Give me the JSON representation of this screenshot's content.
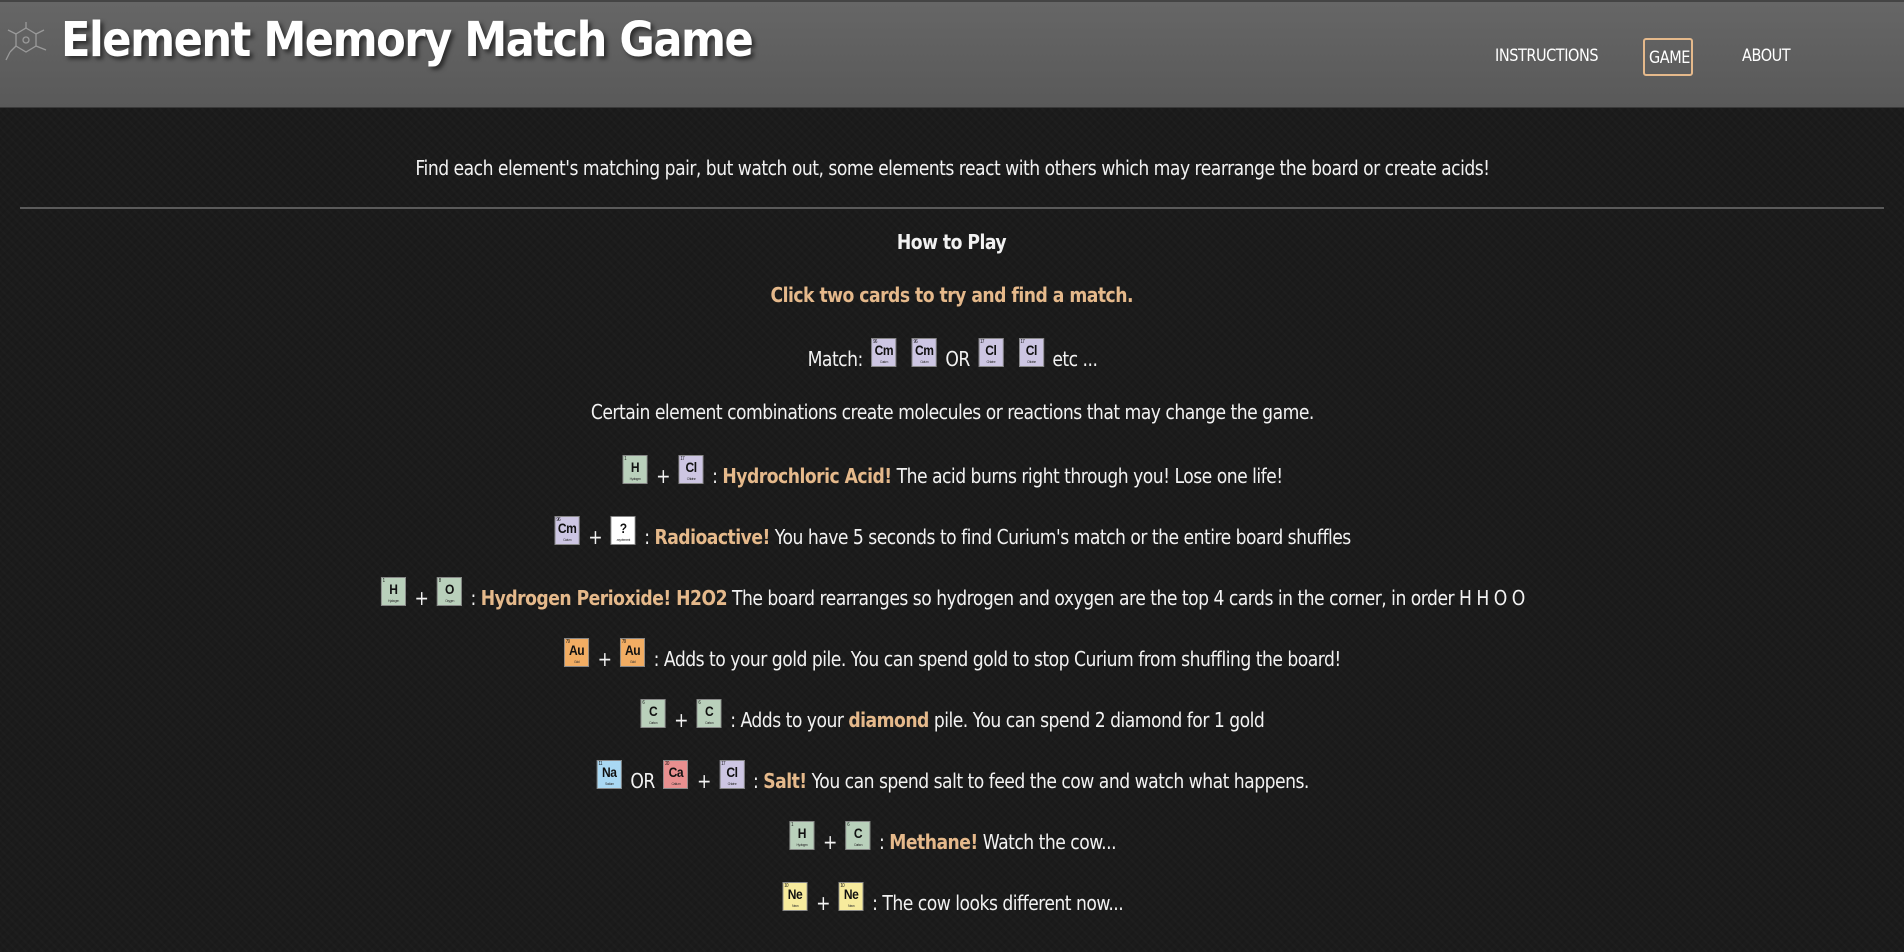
{
  "header": {
    "title": "Element Memory Match Game",
    "nav": [
      {
        "label": "INSTRUCTIONS",
        "active": false
      },
      {
        "label": "GAME",
        "active": true
      },
      {
        "label": "ABOUT",
        "active": false
      }
    ]
  },
  "colors": {
    "header_bg": "#5e5e5e",
    "page_bg": "#1b1b1b",
    "accent": "#e5b98b",
    "tile_green": "#b9d0bb",
    "tile_purple": "#cdc6e3",
    "tile_orange": "#f2ad63",
    "tile_blue": "#a9d8f3",
    "tile_red": "#e88f8f",
    "tile_yellow": "#f7eb9d",
    "tile_white": "#ffffff"
  },
  "intro": "Find each element's matching pair, but watch out, some elements react with others which may rearrange the board or create acids!",
  "how_to_play": {
    "heading": "How to Play",
    "instruction": "Click two cards to try and find a match.",
    "match_label": "Match:",
    "or_label": "OR",
    "etc_label": "etc ...",
    "combos_intro": "Certain element combinations create molecules or reactions that may change the game."
  },
  "tiles": {
    "cm": {
      "symbol": "Cm",
      "number": "96",
      "name": "Curium",
      "color": "#cdc6e3"
    },
    "cl": {
      "symbol": "Cl",
      "number": "17",
      "name": "Chlorine",
      "color": "#cdc6e3"
    },
    "h": {
      "symbol": "H",
      "number": "1",
      "name": "Hydrogen",
      "color": "#b9d0bb"
    },
    "o": {
      "symbol": "O",
      "number": "8",
      "name": "Oxygen",
      "color": "#b9d0bb"
    },
    "c": {
      "symbol": "C",
      "number": "6",
      "name": "Carbon",
      "color": "#b9d0bb"
    },
    "au": {
      "symbol": "Au",
      "number": "79",
      "name": "Gold",
      "color": "#f2ad63"
    },
    "na": {
      "symbol": "Na",
      "number": "11",
      "name": "Sodium",
      "color": "#a9d8f3"
    },
    "ca": {
      "symbol": "Ca",
      "number": "20",
      "name": "Calcium",
      "color": "#e88f8f"
    },
    "ne": {
      "symbol": "Ne",
      "number": "10",
      "name": "Neon",
      "color": "#f7eb9d"
    },
    "q": {
      "symbol": "?",
      "number": "",
      "name": "any element",
      "color": "#ffffff"
    }
  },
  "rules": [
    {
      "tiles": [
        "h",
        "cl"
      ],
      "highlight": "Hydrochloric Acid!",
      "text": "The acid burns right through you! Lose one life!"
    },
    {
      "tiles": [
        "cm",
        "q"
      ],
      "highlight": "Radioactive!",
      "text": "You have 5 seconds to find Curium's match or the entire board shuffles"
    },
    {
      "tiles": [
        "h",
        "o"
      ],
      "highlight": "Hydrogen Perioxide! H2O2",
      "text": "The board rearranges so hydrogen and oxygen are the top 4 cards in the corner, in order H H O O"
    },
    {
      "tiles": [
        "au",
        "au"
      ],
      "highlight": "",
      "text": ": Adds to your gold pile. You can spend gold to stop Curium from shuffling the board!"
    },
    {
      "tiles": [
        "c",
        "c"
      ],
      "prefix": ": Adds to your",
      "highlight": "diamond",
      "text": "pile. You can spend 2 diamond for 1 gold"
    },
    {
      "tiles": [
        "na",
        "ca",
        "cl"
      ],
      "highlight": "Salt!",
      "text": "You can spend salt to feed the cow and watch what happens."
    },
    {
      "tiles": [
        "h",
        "c"
      ],
      "highlight": "Methane!",
      "text": "Watch the cow..."
    },
    {
      "tiles": [
        "ne",
        "ne"
      ],
      "highlight": "",
      "text": ": The cow looks different now..."
    }
  ],
  "plus": "+",
  "colon": ":"
}
